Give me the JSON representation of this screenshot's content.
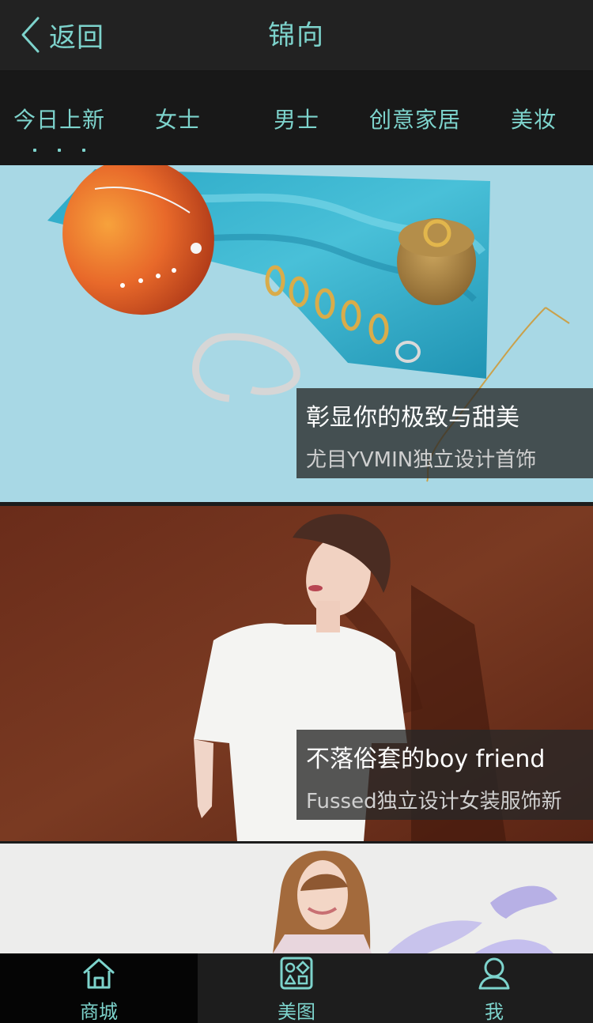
{
  "header": {
    "back_label": "返回",
    "title": "锦向"
  },
  "tabs": [
    {
      "label": "今日上新",
      "active": true
    },
    {
      "label": "女士",
      "active": false
    },
    {
      "label": "男士",
      "active": false
    },
    {
      "label": "创意家居",
      "active": false
    },
    {
      "label": "美妆",
      "active": false
    }
  ],
  "feed": [
    {
      "title": "彰显你的极致与甜美",
      "subtitle": "尤目YVMIN独立设计首饰"
    },
    {
      "title": "不落俗套的boy friend",
      "subtitle": "Fussed独立设计女装服饰新"
    },
    {
      "title": "",
      "subtitle": ""
    }
  ],
  "bottom_nav": [
    {
      "label": "商城",
      "icon": "home-icon",
      "active": true
    },
    {
      "label": "美图",
      "icon": "gallery-icon",
      "active": false
    },
    {
      "label": "我",
      "icon": "user-icon",
      "active": false
    }
  ],
  "colors": {
    "accent": "#7dd3cc",
    "header_bg": "#222222",
    "tabs_bg": "#181818",
    "nav_active_bg": "#050505"
  }
}
